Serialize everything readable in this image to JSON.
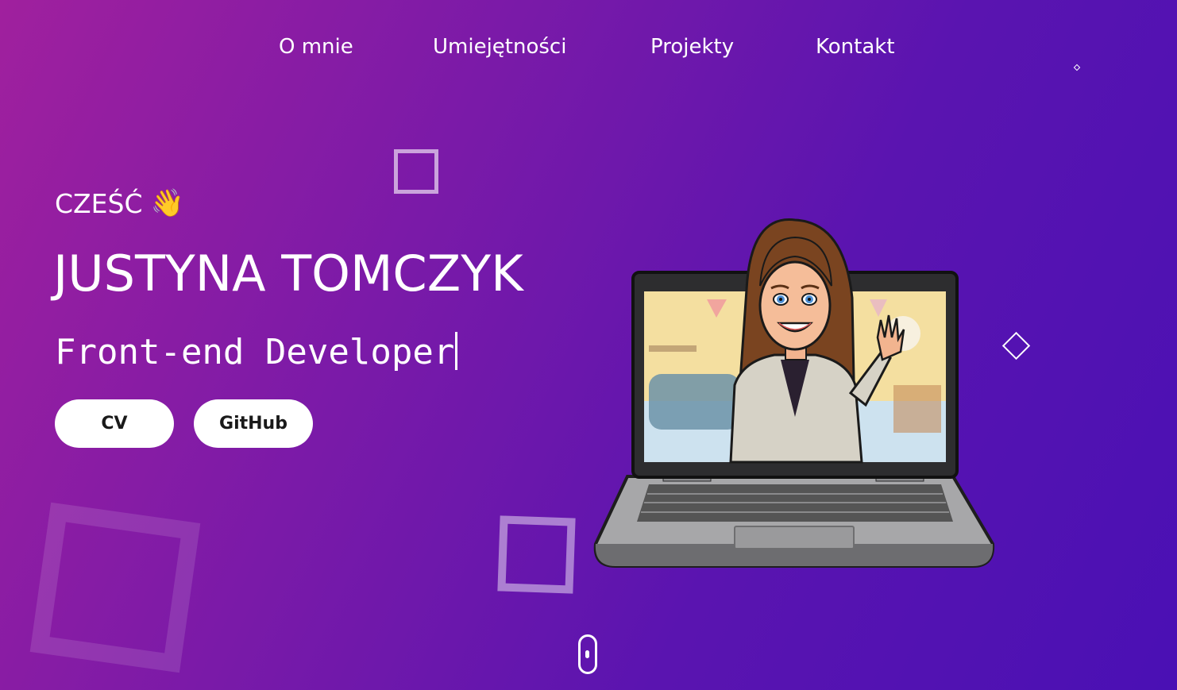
{
  "nav": {
    "items": [
      {
        "label": "O mnie"
      },
      {
        "label": "Umiejętności"
      },
      {
        "label": "Projekty"
      },
      {
        "label": "Kontakt"
      }
    ]
  },
  "hero": {
    "greeting": "CZEŚĆ",
    "greeting_emoji": "👋",
    "name": "JUSTYNA TOMCZYK",
    "role": "Front-end Developer",
    "buttons": {
      "cv_label": "CV",
      "github_label": "GitHub"
    }
  },
  "illustration": {
    "subject": "avatar-waving-from-laptop-icon"
  },
  "colors": {
    "gradient_start": "#a0209e",
    "gradient_end": "#4a10b4",
    "button_bg": "#ffffff",
    "button_text": "#1a1a1a"
  }
}
